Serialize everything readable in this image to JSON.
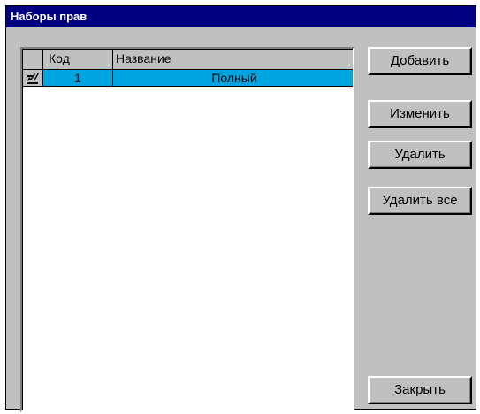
{
  "window": {
    "title": "Наборы прав"
  },
  "table": {
    "columns": [
      "Код",
      "Название"
    ],
    "rows": [
      {
        "code": "1",
        "name": "Полный",
        "selected": true,
        "row_icon": "edit-pencil-icon"
      }
    ],
    "selection_color": "#00a5e0"
  },
  "buttons": {
    "add": "Добавить",
    "edit": "Изменить",
    "delete": "Удалить",
    "delete_all": "Удалить все",
    "close": "Закрыть"
  },
  "colors": {
    "titlebar": "#000080",
    "face": "#c0c0c0"
  }
}
